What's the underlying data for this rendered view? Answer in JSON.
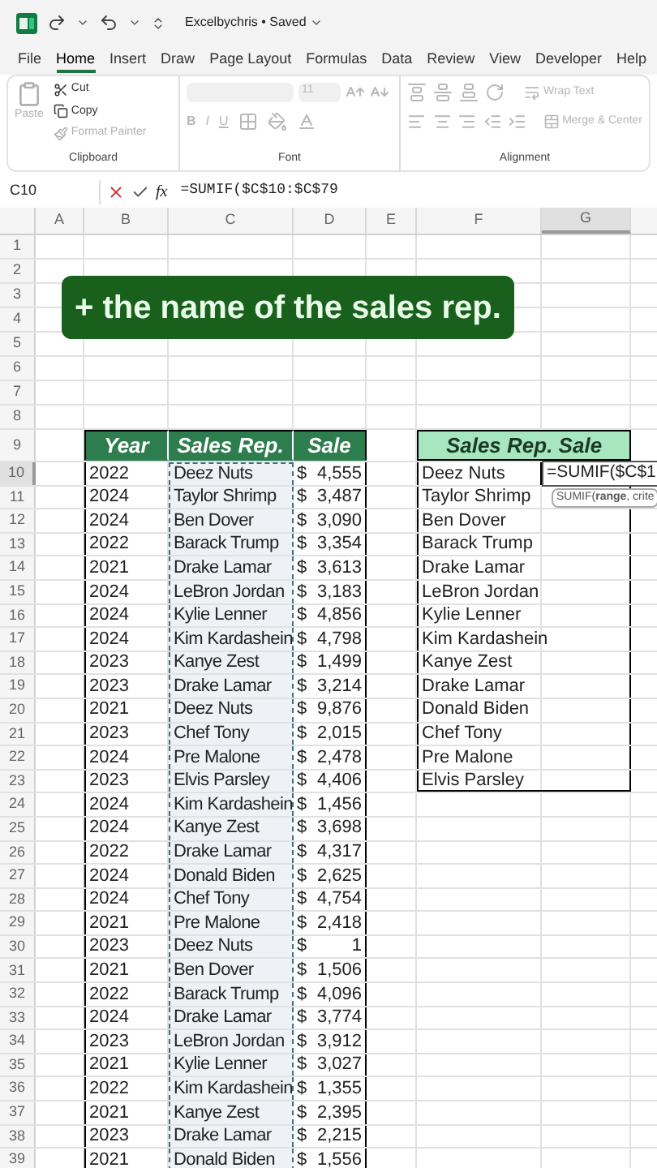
{
  "title_bar": {
    "title": "Excelbychris • Saved"
  },
  "menu_tabs": [
    {
      "label": "File",
      "selected": false
    },
    {
      "label": "Home",
      "selected": true
    },
    {
      "label": "Insert",
      "selected": false
    },
    {
      "label": "Draw",
      "selected": false
    },
    {
      "label": "Page Layout",
      "selected": false
    },
    {
      "label": "Formulas",
      "selected": false
    },
    {
      "label": "Data",
      "selected": false
    },
    {
      "label": "Review",
      "selected": false
    },
    {
      "label": "View",
      "selected": false
    },
    {
      "label": "Developer",
      "selected": false
    },
    {
      "label": "Help",
      "selected": false
    }
  ],
  "ribbon": {
    "clipboard": {
      "label": "Clipboard",
      "paste": {
        "label": "Paste",
        "disabled": true
      },
      "cut": {
        "label": "Cut",
        "disabled": false
      },
      "copy": {
        "label": "Copy",
        "disabled": false
      },
      "format_painter": {
        "label": "Format Painter",
        "disabled": true
      }
    },
    "font": {
      "label": "Font",
      "size": "11",
      "bold": "B",
      "italic": "I",
      "underline": "U",
      "disabled": true
    },
    "alignment": {
      "label": "Alignment",
      "wrap_text": "Wrap Text",
      "merge": "Merge & Center",
      "disabled": true
    }
  },
  "formula_bar": {
    "name_box": "C10",
    "function_label": "fx",
    "formula": "=SUMIF($C$10:$C$79"
  },
  "columns": [
    {
      "label": "A",
      "selected": false
    },
    {
      "label": "B",
      "selected": false
    },
    {
      "label": "C",
      "selected": false
    },
    {
      "label": "D",
      "selected": false
    },
    {
      "label": "E",
      "selected": false
    },
    {
      "label": "F",
      "selected": false
    },
    {
      "label": "G",
      "selected": true
    }
  ],
  "row_numbers": [
    {
      "label": "1",
      "selected": false
    },
    {
      "label": "2",
      "selected": false
    },
    {
      "label": "3",
      "selected": false
    },
    {
      "label": "4",
      "selected": false
    },
    {
      "label": "5",
      "selected": false
    },
    {
      "label": "6",
      "selected": false
    },
    {
      "label": "7",
      "selected": false
    },
    {
      "label": "8",
      "selected": false
    },
    {
      "label": "9",
      "selected": false
    },
    {
      "label": "10",
      "selected": true
    },
    {
      "label": "11",
      "selected": false
    },
    {
      "label": "12",
      "selected": false
    },
    {
      "label": "13",
      "selected": false
    },
    {
      "label": "14",
      "selected": false
    },
    {
      "label": "15",
      "selected": false
    },
    {
      "label": "16",
      "selected": false
    },
    {
      "label": "17",
      "selected": false
    },
    {
      "label": "18",
      "selected": false
    },
    {
      "label": "19",
      "selected": false
    },
    {
      "label": "20",
      "selected": false
    },
    {
      "label": "21",
      "selected": false
    },
    {
      "label": "22",
      "selected": false
    },
    {
      "label": "23",
      "selected": false
    },
    {
      "label": "24",
      "selected": false
    },
    {
      "label": "25",
      "selected": false
    },
    {
      "label": "26",
      "selected": false
    },
    {
      "label": "27",
      "selected": false
    },
    {
      "label": "28",
      "selected": false
    },
    {
      "label": "29",
      "selected": false
    },
    {
      "label": "30",
      "selected": false
    },
    {
      "label": "31",
      "selected": false
    },
    {
      "label": "32",
      "selected": false
    },
    {
      "label": "33",
      "selected": false
    },
    {
      "label": "34",
      "selected": false
    },
    {
      "label": "35",
      "selected": false
    },
    {
      "label": "36",
      "selected": false
    },
    {
      "label": "37",
      "selected": false
    },
    {
      "label": "38",
      "selected": false
    },
    {
      "label": "39",
      "selected": false
    }
  ],
  "banner": "+ the name of the sales rep.",
  "sales_table": {
    "columns": [
      "Year",
      "Sales Rep.",
      "Sale"
    ],
    "rows": [
      {
        "year": "2022",
        "rep": "Deez Nuts",
        "currency": "$",
        "amount": "4,555"
      },
      {
        "year": "2024",
        "rep": "Taylor Shrimp",
        "currency": "$",
        "amount": "3,487"
      },
      {
        "year": "2024",
        "rep": "Ben Dover",
        "currency": "$",
        "amount": "3,090"
      },
      {
        "year": "2022",
        "rep": "Barack Trump",
        "currency": "$",
        "amount": "3,354"
      },
      {
        "year": "2021",
        "rep": "Drake Lamar",
        "currency": "$",
        "amount": "3,613"
      },
      {
        "year": "2024",
        "rep": "LeBron Jordan",
        "currency": "$",
        "amount": "3,183"
      },
      {
        "year": "2024",
        "rep": "Kylie Lenner",
        "currency": "$",
        "amount": "4,856"
      },
      {
        "year": "2024",
        "rep": "Kim Kardashein",
        "currency": "$",
        "amount": "4,798"
      },
      {
        "year": "2023",
        "rep": "Kanye Zest",
        "currency": "$",
        "amount": "1,499"
      },
      {
        "year": "2023",
        "rep": "Drake Lamar",
        "currency": "$",
        "amount": "3,214"
      },
      {
        "year": "2021",
        "rep": "Deez Nuts",
        "currency": "$",
        "amount": "9,876"
      },
      {
        "year": "2023",
        "rep": "Chef Tony",
        "currency": "$",
        "amount": "2,015"
      },
      {
        "year": "2024",
        "rep": "Pre Malone",
        "currency": "$",
        "amount": "2,478"
      },
      {
        "year": "2023",
        "rep": "Elvis Parsley",
        "currency": "$",
        "amount": "4,406"
      },
      {
        "year": "2024",
        "rep": "Kim Kardashein",
        "currency": "$",
        "amount": "1,456"
      },
      {
        "year": "2024",
        "rep": "Kanye Zest",
        "currency": "$",
        "amount": "3,698"
      },
      {
        "year": "2022",
        "rep": "Drake Lamar",
        "currency": "$",
        "amount": "4,317"
      },
      {
        "year": "2024",
        "rep": "Donald Biden",
        "currency": "$",
        "amount": "2,625"
      },
      {
        "year": "2024",
        "rep": "Chef Tony",
        "currency": "$",
        "amount": "4,754"
      },
      {
        "year": "2021",
        "rep": "Pre Malone",
        "currency": "$",
        "amount": "2,418"
      },
      {
        "year": "2023",
        "rep": "Deez Nuts",
        "currency": "$",
        "amount": "1"
      },
      {
        "year": "2021",
        "rep": "Ben Dover",
        "currency": "$",
        "amount": "1,506"
      },
      {
        "year": "2022",
        "rep": "Barack Trump",
        "currency": "$",
        "amount": "4,096"
      },
      {
        "year": "2024",
        "rep": "Drake Lamar",
        "currency": "$",
        "amount": "3,774"
      },
      {
        "year": "2023",
        "rep": "LeBron Jordan",
        "currency": "$",
        "amount": "3,912"
      },
      {
        "year": "2021",
        "rep": "Kylie Lenner",
        "currency": "$",
        "amount": "3,027"
      },
      {
        "year": "2022",
        "rep": "Kim Kardashein",
        "currency": "$",
        "amount": "1,355"
      },
      {
        "year": "2021",
        "rep": "Kanye Zest",
        "currency": "$",
        "amount": "2,395"
      },
      {
        "year": "2023",
        "rep": "Drake Lamar",
        "currency": "$",
        "amount": "2,215"
      },
      {
        "year": "2021",
        "rep": "Donald Biden",
        "currency": "$",
        "amount": "1,556"
      }
    ]
  },
  "summary_table": {
    "title": "Sales Rep. Sale",
    "rows": [
      "Deez Nuts",
      "Taylor Shrimp",
      "Ben Dover",
      "Barack Trump",
      "Drake Lamar",
      "LeBron Jordan",
      "Kylie Lenner",
      "Kim Kardashein",
      "Kanye Zest",
      "Drake Lamar",
      "Donald Biden",
      "Chef Tony",
      "Pre Malone",
      "Elvis Parsley"
    ]
  },
  "editing_cell": "=SUMIF($C$1",
  "tooltip": "SUMIF(**range**, crite"
}
